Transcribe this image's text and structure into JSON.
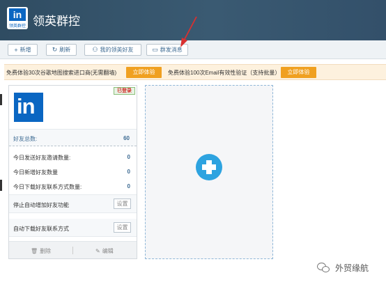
{
  "app": {
    "title": "领英群控",
    "logo_text": "in",
    "logo_sub": "领英群控"
  },
  "toolbar": {
    "add_label": "新增",
    "refresh_label": "刷新",
    "my_friends_label": "我的领英好友",
    "mass_message_label": "群发消息"
  },
  "notice": {
    "offer1": "免费体验30次谷歌地图搜索进口商(无需翻墙)",
    "offer1_button": "立即体验",
    "offer2": "免费体验100次Email有效性验证（支持批量）",
    "offer2_button": "立即体验"
  },
  "account_card": {
    "status": "已登录",
    "logo_text": "in",
    "total_friends_label": "好友总数:",
    "total_friends_value": "60",
    "stats": [
      {
        "label": "今日发送好友邀请数量:",
        "value": "0"
      },
      {
        "label": "今日新增好友数量",
        "value": "0"
      },
      {
        "label": "今日下载好友联系方式数量:",
        "value": "0"
      }
    ],
    "settings": [
      {
        "label": "停止自动增加好友功能",
        "button": "设置"
      },
      {
        "label": "自动下载好友联系方式",
        "button": "设置"
      }
    ],
    "delete_label": "删除",
    "edit_label": "编辑"
  },
  "watermark": {
    "text": "外贸缘航"
  },
  "colors": {
    "header": "#2f4c62",
    "accent": "#3c6a92",
    "button_orange": "#f0a020",
    "add_blue": "#2da3e0",
    "arrow_red": "#d93030"
  }
}
